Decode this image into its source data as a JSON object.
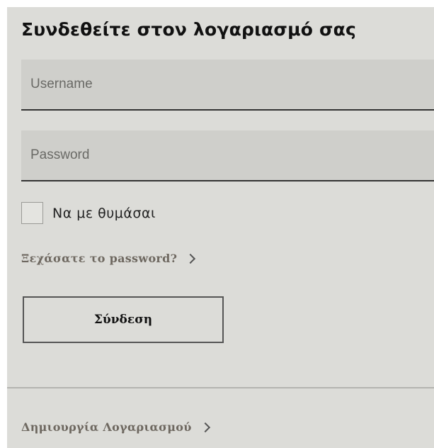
{
  "login": {
    "title": "Συνδεθείτε στον λογαριασμό σας",
    "username": {
      "value": "",
      "placeholder": "Username"
    },
    "password": {
      "value": "",
      "placeholder": "Password"
    },
    "remember_me": {
      "label": "Να με θυμάσαι",
      "checked": false
    },
    "forgot_password": {
      "label": "Ξεχάσατε το password?",
      "icon": "chevron-right-icon"
    },
    "submit_label": "Σύνδεση",
    "create_account": {
      "label": "Δημιουργία Λογαριασμού",
      "icon": "chevron-right-icon"
    }
  },
  "colors": {
    "panel_bg": "#dcdcd8",
    "field_bg": "#cfcfcb",
    "link_text": "#6e6860",
    "border": "#555555"
  }
}
